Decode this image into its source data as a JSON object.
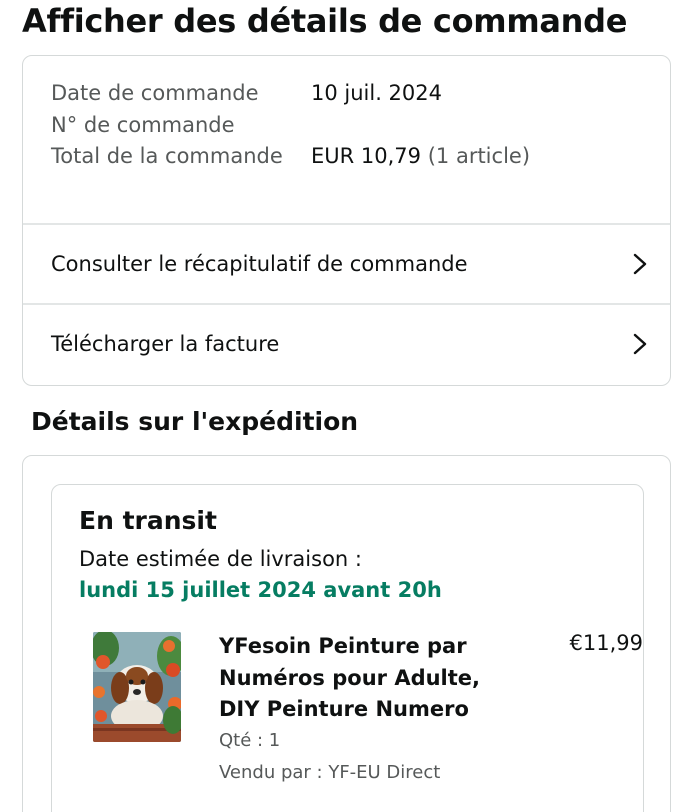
{
  "page": {
    "title": "Afficher des détails de commande"
  },
  "order_summary": {
    "date_label": "Date de commande",
    "date_value": "10 juil. 2024",
    "number_label": "N° de commande",
    "total_label": "Total de la commande",
    "total_value": "EUR 10,79",
    "total_items": "(1 article)"
  },
  "actions": [
    {
      "label": "Consulter le récapitulatif de commande",
      "icon": "chevron-right-icon"
    },
    {
      "label": "Télécharger la facture",
      "icon": "chevron-right-icon"
    }
  ],
  "shipping": {
    "section_title": "Détails sur l'expédition",
    "status": "En transit",
    "eta_label": "Date estimée de livraison :",
    "eta_date": "lundi 15 juillet 2024 avant 20h",
    "eta_color": "#067d62",
    "item": {
      "name": "YFesoin Peinture par Numéros pour Adulte, DIY Peinture Numero",
      "price": "€11,99",
      "quantity": "Qté : 1",
      "seller": "Vendu par : YF-EU Direct"
    }
  }
}
